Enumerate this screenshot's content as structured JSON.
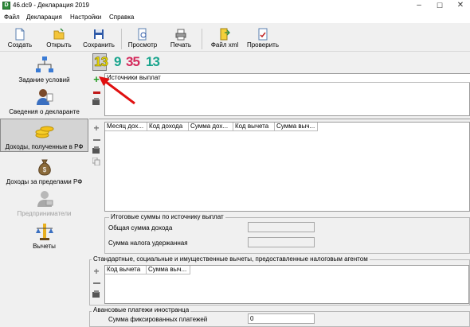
{
  "window": {
    "title": "46.dc9 - Декларация 2019",
    "app_icon": "D",
    "min_symbol": "–",
    "max_symbol": "☐",
    "close_symbol": "✕"
  },
  "menu": [
    "Файл",
    "Декларация",
    "Настройки",
    "Справка"
  ],
  "toolbar": {
    "create": "Создать",
    "open": "Открыть",
    "save": "Сохранить",
    "preview": "Просмотр",
    "print": "Печать",
    "xml": "Файл xml",
    "check": "Проверить"
  },
  "sidebar": {
    "items": [
      {
        "label": "Задание условий",
        "icon": "network-icon"
      },
      {
        "label": "Сведения о декларанте",
        "icon": "person-icon"
      },
      {
        "label": "Доходы, полученные в РФ",
        "icon": "coins-icon"
      },
      {
        "label": "Доходы за пределами РФ",
        "icon": "money-bag-icon"
      },
      {
        "label": "Предприниматели",
        "icon": "entrepreneur-icon"
      },
      {
        "label": "Вычеты",
        "icon": "scales-icon"
      }
    ]
  },
  "tabs": [
    {
      "label": "13",
      "color": "#e8d800"
    },
    {
      "label": "9",
      "color": "#1aa58e"
    },
    {
      "label": "35",
      "color": "#d42a5c"
    },
    {
      "label": "13",
      "color": "#1aa58e"
    }
  ],
  "sources": {
    "header": "Источники выплат"
  },
  "income_table": {
    "headers": [
      "Месяц дох...",
      "Код дохода",
      "Сумма дох...",
      "Код вычета",
      "Сумма выч..."
    ]
  },
  "totals": {
    "title": "Итоговые суммы по источнику выплат",
    "total_income_label": "Общая сумма дохода",
    "total_tax_label": "Сумма налога удержанная"
  },
  "deductions": {
    "title": "Стандартные, социальные и имущественные вычеты, предоставленные налоговым агентом",
    "headers": [
      "Код вычета",
      "Сумма выч..."
    ]
  },
  "advance": {
    "title": "Авансовые платежи иностранца",
    "fixed_label": "Сумма фиксированных платежей",
    "fixed_value": "0"
  },
  "colors": {
    "add": "#1e9a1e",
    "remove": "#c01818",
    "arrow": "#e01010"
  }
}
